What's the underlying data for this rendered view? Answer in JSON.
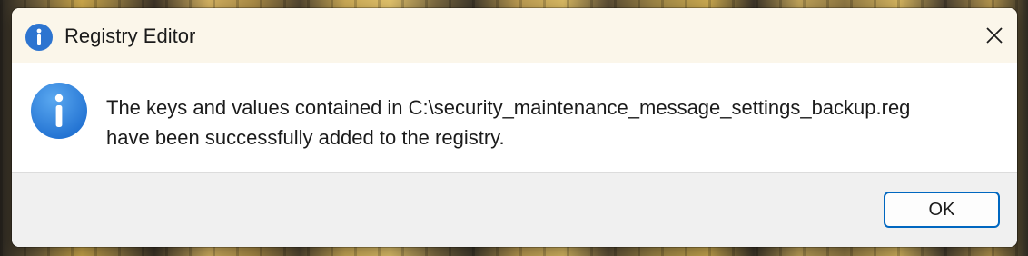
{
  "window": {
    "title": "Registry Editor",
    "title_icon": "info-icon",
    "close_icon": "close-icon"
  },
  "message": {
    "icon": "info-icon",
    "line1": "The keys and values contained in C:\\security_maintenance_message_settings_backup.reg",
    "line2": "have been successfully added to the registry."
  },
  "buttons": {
    "ok_label": "OK"
  },
  "colors": {
    "accent": "#0067c0",
    "info_blue": "#2d7fd8",
    "titlebar_bg": "#fbf6ea",
    "footer_bg": "#f0f0f0"
  }
}
